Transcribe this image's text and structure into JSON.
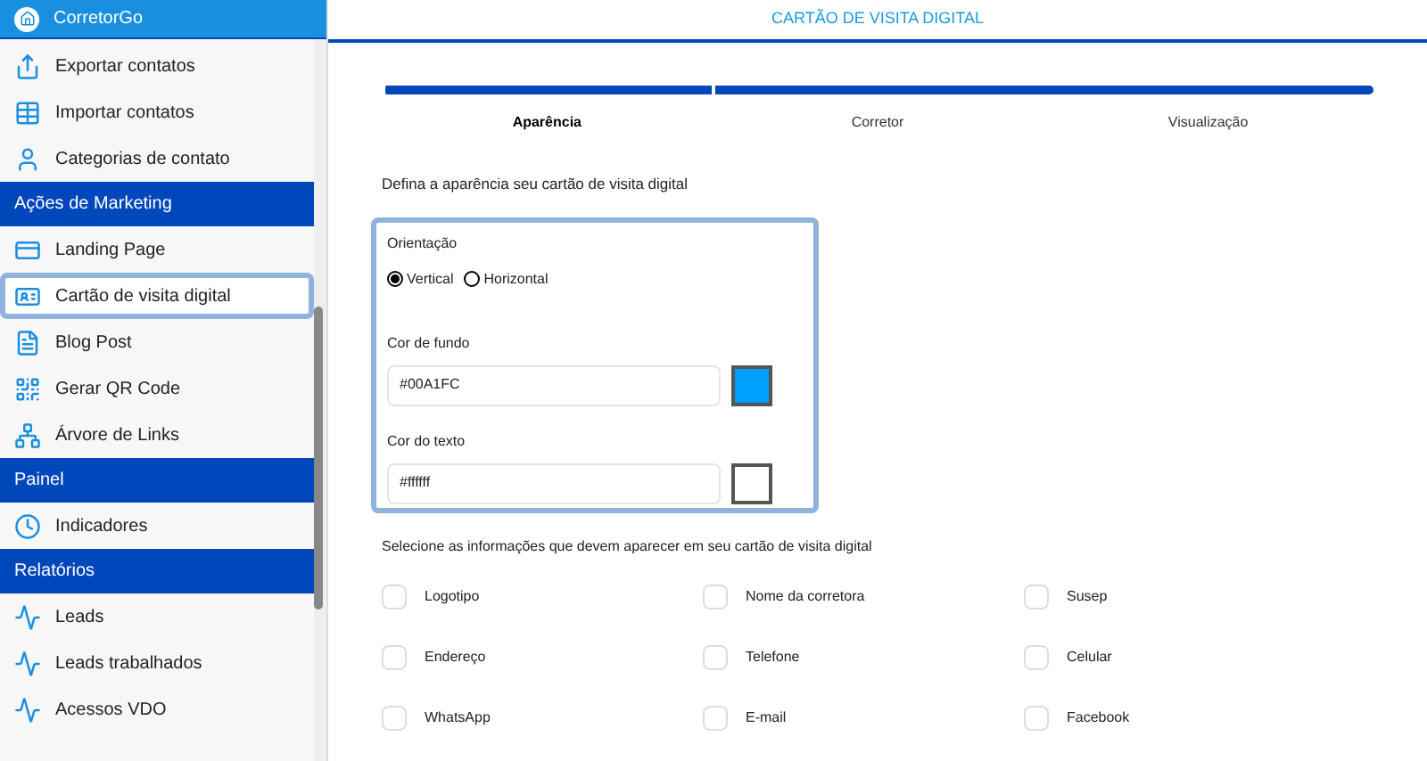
{
  "sidebar": {
    "brand": "CorretorGo",
    "items": [
      {
        "kind": "item",
        "label": "Exportar contatos",
        "selected": false
      },
      {
        "kind": "item",
        "label": "Importar contatos",
        "selected": false
      },
      {
        "kind": "item",
        "label": "Categorias de contato",
        "selected": false
      },
      {
        "kind": "section",
        "label": "Ações de Marketing"
      },
      {
        "kind": "item",
        "label": "Landing Page",
        "selected": false
      },
      {
        "kind": "item",
        "label": "Cartão de visita digital",
        "selected": true
      },
      {
        "kind": "item",
        "label": "Blog Post",
        "selected": false
      },
      {
        "kind": "item",
        "label": "Gerar QR Code",
        "selected": false
      },
      {
        "kind": "item",
        "label": "Árvore de Links",
        "selected": false
      },
      {
        "kind": "section",
        "label": "Painel"
      },
      {
        "kind": "item",
        "label": "Indicadores",
        "selected": false
      },
      {
        "kind": "section",
        "label": "Relatórios"
      },
      {
        "kind": "item",
        "label": "Leads",
        "selected": false
      },
      {
        "kind": "item",
        "label": "Leads trabalhados",
        "selected": false
      },
      {
        "kind": "item",
        "label": "Acessos VDO",
        "selected": false
      }
    ]
  },
  "page_title": "CARTÃO DE VISITA DIGITAL",
  "steps": [
    {
      "label": "Aparência",
      "selected": true
    },
    {
      "label": "Corretor",
      "selected": false
    },
    {
      "label": "Visualização",
      "selected": false
    }
  ],
  "intro": "Defina a aparência seu cartão de visita digital",
  "appearance": {
    "orientation_label": "Orientação",
    "orientations": [
      {
        "label": "Vertical",
        "selected": true
      },
      {
        "label": "Horizontal",
        "selected": false
      }
    ],
    "colors": [
      {
        "label": "Cor de fundo",
        "value": "#00A1FC",
        "color": "#00a1fc"
      },
      {
        "label": "Cor do texto",
        "value": "#ffffff",
        "color": "#ffffff"
      }
    ]
  },
  "fields_prompt": "Selecione as informações que devem aparecer em seu cartão de visita digital",
  "fields": [
    {
      "label": "Logotipo",
      "checked": false
    },
    {
      "label": "Nome da corretora",
      "checked": false
    },
    {
      "label": "Susep",
      "checked": false
    },
    {
      "label": "Endereço",
      "checked": false
    },
    {
      "label": "Telefone",
      "checked": false
    },
    {
      "label": "Celular",
      "checked": false
    },
    {
      "label": "WhatsApp",
      "checked": false
    },
    {
      "label": "E-mail",
      "checked": false
    },
    {
      "label": "Facebook",
      "checked": false
    }
  ]
}
